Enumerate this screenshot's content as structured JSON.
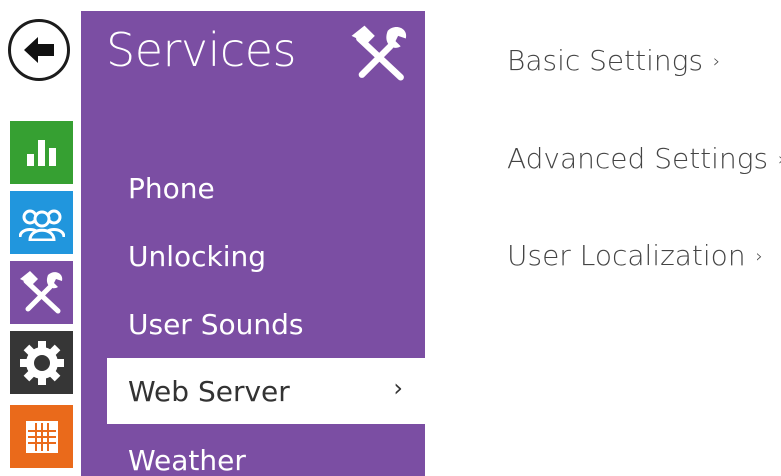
{
  "rail": {
    "back_icon": "back-arrow-icon",
    "tiles": [
      {
        "name": "status",
        "icon": "bar-chart-icon",
        "color": "#36a032"
      },
      {
        "name": "directory",
        "icon": "users-icon",
        "color": "#2196dd"
      },
      {
        "name": "services",
        "icon": "tools-icon",
        "color": "#7b4ea3"
      },
      {
        "name": "hardware",
        "icon": "gear-icon",
        "color": "#363636"
      },
      {
        "name": "system",
        "icon": "grid-icon",
        "color": "#ea6a1b"
      }
    ]
  },
  "panel": {
    "title": "Services",
    "icon": "tools-icon",
    "color": "#7b4ea3",
    "items": [
      {
        "label": "Phone",
        "active": false
      },
      {
        "label": "Unlocking",
        "active": false
      },
      {
        "label": "User Sounds",
        "active": false
      },
      {
        "label": "Web Server",
        "active": true,
        "chevron": "›"
      },
      {
        "label": "Weather",
        "active": false
      }
    ]
  },
  "content": {
    "links": [
      {
        "label": "Basic Settings",
        "chevron": "›"
      },
      {
        "label": "Advanced Settings",
        "chevron": "›"
      },
      {
        "label": "User Localization",
        "chevron": "›"
      }
    ]
  }
}
